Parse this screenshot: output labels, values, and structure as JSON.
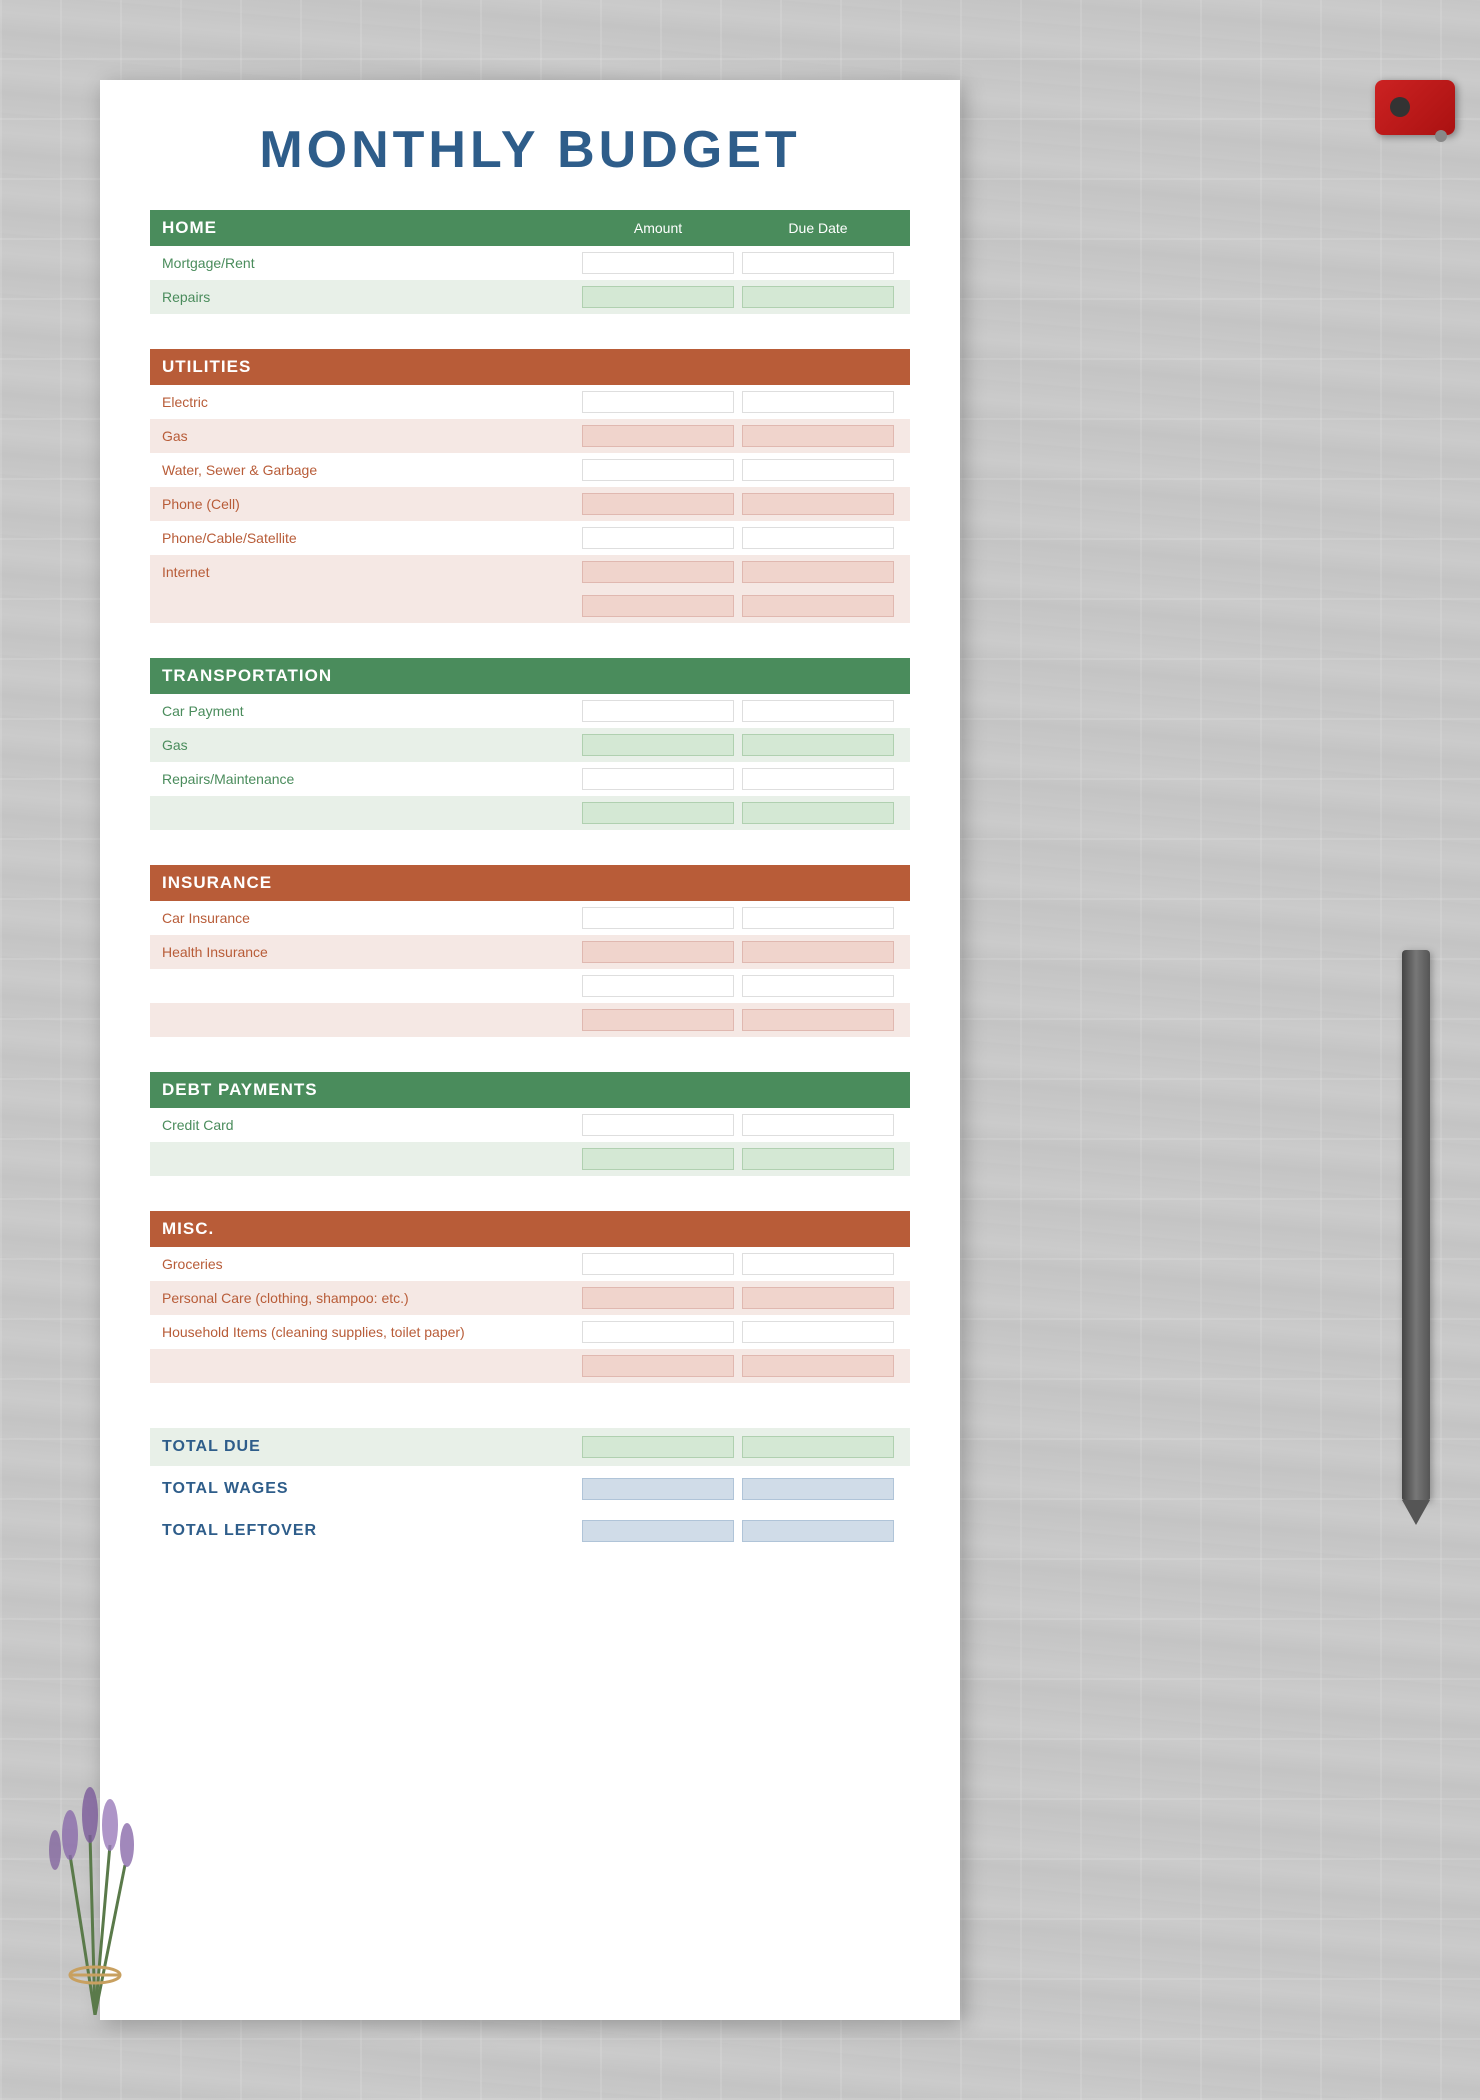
{
  "page": {
    "title": "MONTHLY BUDGET"
  },
  "sections": {
    "home": {
      "label": "HOME",
      "color": "green",
      "amount_col": "Amount",
      "due_date_col": "Due Date",
      "rows": [
        {
          "label": "Mortgage/Rent",
          "style": "plain",
          "label_color": "green-text"
        },
        {
          "label": "Repairs",
          "style": "light-green",
          "label_color": "green-text"
        }
      ]
    },
    "utilities": {
      "label": "UTILITIES",
      "color": "brown",
      "rows": [
        {
          "label": "Electric",
          "style": "plain",
          "label_color": "brown-text"
        },
        {
          "label": "Gas",
          "style": "light-pink",
          "label_color": "brown-text"
        },
        {
          "label": "Water, Sewer & Garbage",
          "style": "plain",
          "label_color": "brown-text"
        },
        {
          "label": "Phone (Cell)",
          "style": "light-pink",
          "label_color": "brown-text"
        },
        {
          "label": "Phone/Cable/Satellite",
          "style": "plain",
          "label_color": "brown-text"
        },
        {
          "label": "Internet",
          "style": "light-pink",
          "label_color": "brown-text"
        },
        {
          "label": "",
          "style": "light-pink",
          "label_color": "brown-text"
        }
      ]
    },
    "transportation": {
      "label": "TRANSPORTATION",
      "color": "green",
      "rows": [
        {
          "label": "Car Payment",
          "style": "plain",
          "label_color": "green-text"
        },
        {
          "label": "Gas",
          "style": "light-green",
          "label_color": "green-text"
        },
        {
          "label": "Repairs/Maintenance",
          "style": "plain",
          "label_color": "green-text"
        },
        {
          "label": "",
          "style": "light-green",
          "label_color": "green-text"
        }
      ]
    },
    "insurance": {
      "label": "INSURANCE",
      "color": "brown",
      "rows": [
        {
          "label": "Car Insurance",
          "style": "plain",
          "label_color": "brown-text"
        },
        {
          "label": "Health Insurance",
          "style": "light-pink",
          "label_color": "brown-text"
        },
        {
          "label": "",
          "style": "plain",
          "label_color": "brown-text"
        },
        {
          "label": "",
          "style": "light-pink",
          "label_color": "brown-text"
        }
      ]
    },
    "debt": {
      "label": "DEBT PAYMENTS",
      "color": "green",
      "rows": [
        {
          "label": "Credit Card",
          "style": "plain",
          "label_color": "green-text"
        },
        {
          "label": "",
          "style": "light-green",
          "label_color": "green-text"
        }
      ]
    },
    "misc": {
      "label": "MISC.",
      "color": "brown",
      "rows": [
        {
          "label": "Groceries",
          "style": "plain",
          "label_color": "brown-text"
        },
        {
          "label": "Personal Care (clothing, shampoo: etc.)",
          "style": "light-pink",
          "label_color": "brown-text"
        },
        {
          "label": "Household Items (cleaning supplies, toilet paper)",
          "style": "plain",
          "label_color": "brown-text"
        },
        {
          "label": "",
          "style": "light-pink",
          "label_color": "brown-text"
        }
      ]
    }
  },
  "totals": {
    "total_due": "TOTAL DUE",
    "total_wages": "TOTAL WAGES",
    "total_leftover": "TOTAL LEFTOVER"
  }
}
